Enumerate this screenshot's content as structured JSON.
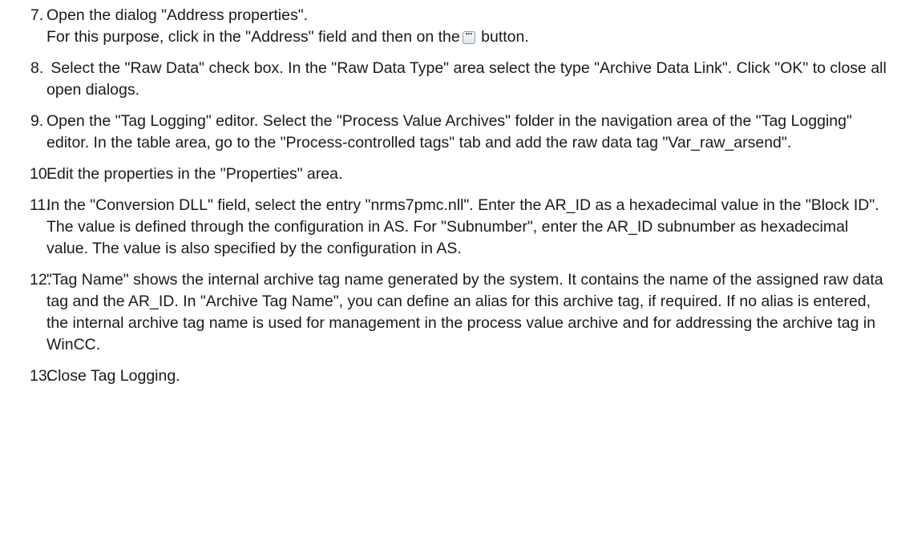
{
  "steps": [
    {
      "number": "7.",
      "lines": [
        "Open the dialog \"Address properties\".",
        "For this purpose, click in the \"Address\" field and then on the",
        "button."
      ],
      "button_icon": "ellipsis-button-icon",
      "button_glyph": "..."
    },
    {
      "number": "8.",
      "text": " Select the \"Raw Data\" check box. In the \"Raw Data Type\" area select the type \"Archive Data Link\". Click \"OK\" to close all open dialogs."
    },
    {
      "number": "9.",
      "text": "Open the \"Tag Logging\" editor. Select the \"Process Value Archives\" folder in the navigation area of the \"Tag Logging\" editor. In the table area, go to the \"Process-controlled tags\" tab and add the raw data tag \"Var_raw_arsend\"."
    },
    {
      "number": "10.",
      "text": "Edit the properties in the \"Properties\" area."
    },
    {
      "number": "11.",
      "text": "In the \"Conversion DLL\" field, select the entry \"nrms7pmc.nll\". Enter the AR_ID as a hexadecimal value in the \"Block ID\". The value is defined through the configuration in AS. For \"Subnumber\", enter the AR_ID subnumber as hexadecimal value. The value is also specified by the configuration in AS."
    },
    {
      "number": "12.",
      "text": "\"Tag Name\" shows the internal archive tag name generated by the system. It contains the name of the assigned raw data tag and the AR_ID. In \"Archive Tag Name\", you can define an alias for this archive tag, if required. If no alias is entered, the internal archive tag name is used for management in the process value archive and for addressing the archive tag in WinCC."
    },
    {
      "number": "13.",
      "text": "Close Tag Logging."
    }
  ]
}
